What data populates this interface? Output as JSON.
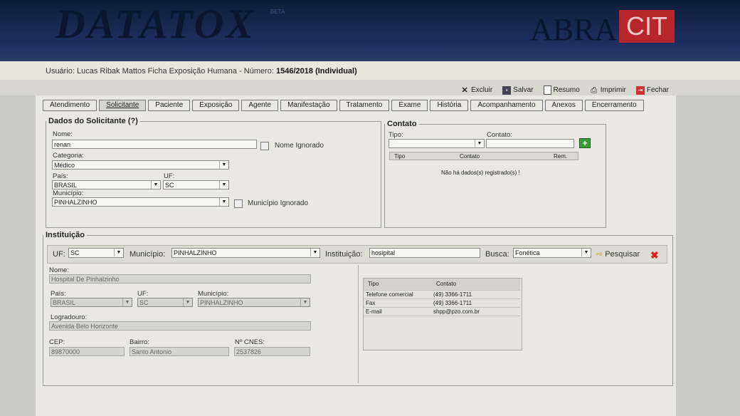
{
  "header": {
    "logo_text": "DATATOX",
    "logo_badge": "BETA",
    "partner_a": "ABRA",
    "partner_b": "CIT"
  },
  "user_line": {
    "prefix": "Usuário: Lucas Ribak Mattos  Ficha Exposição Humana - Número:",
    "number": "1546/2018 (Individual)"
  },
  "toolbar": {
    "excluir": "Excluir",
    "salvar": "Salvar",
    "resumo": "Resumo",
    "imprimir": "Imprimir",
    "fechar": "Fechar"
  },
  "tabs": [
    "Atendimento",
    "Solicitante",
    "Paciente",
    "Exposição",
    "Agente",
    "Manifestação",
    "Tratamento",
    "Exame",
    "História",
    "Acompanhamento",
    "Anexos",
    "Encerramento"
  ],
  "solicitante": {
    "legend": "Dados do Solicitante",
    "help": "(?)",
    "nome_label": "Nome:",
    "nome_value": "renan",
    "nome_ignorado": "Nome Ignorado",
    "categoria_label": "Categoria:",
    "categoria_value": "Médico",
    "pais_label": "País:",
    "pais_value": "BRASIL",
    "uf_label": "UF:",
    "uf_value": "SC",
    "municipio_label": "Município:",
    "municipio_value": "PINHALZINHO",
    "municipio_ignorado": "Município Ignorado"
  },
  "contato": {
    "legend": "Contato",
    "tipo_label": "Tipo:",
    "contato_label": "Contato:",
    "col_tipo": "Tipo",
    "col_contato": "Contato",
    "col_rem": "Rem.",
    "empty": "Não há dados(s) registrado(s) !"
  },
  "instituicao": {
    "legend": "Instituição",
    "uf_label": "UF:",
    "uf_value": "SC",
    "municipio_label": "Município:",
    "municipio_value": "PINHALZINHO",
    "inst_label": "Instituição:",
    "inst_value": "hosipital",
    "busca_label": "Busca:",
    "busca_value": "Fonética",
    "pesquisar": "Pesquisar",
    "nome_label": "Nome:",
    "nome_value": "Hospital De Pinhalzinho",
    "pais_label": "País:",
    "pais_value": "BRASIL",
    "uf2_label": "UF:",
    "uf2_value": "SC",
    "mun2_label": "Município:",
    "mun2_value": "PINHALZINHO",
    "logradouro_label": "Logradouro:",
    "logradouro_value": "Avenida Belo Horizonte",
    "cep_label": "CEP:",
    "cep_value": "89870000",
    "bairro_label": "Bairro:",
    "bairro_value": "Santo Antonio",
    "cnes_label": "Nº CNES:",
    "cnes_value": "2537826",
    "contacts_header": {
      "tipo": "Tipo",
      "contato": "Contato"
    },
    "contacts": [
      {
        "tipo": "Telefone comercial",
        "contato": "(49) 3366-1711"
      },
      {
        "tipo": "Fax",
        "contato": "(49) 3366-1711"
      },
      {
        "tipo": "E-mail",
        "contato": "shpp@pzo.com.br"
      }
    ]
  }
}
